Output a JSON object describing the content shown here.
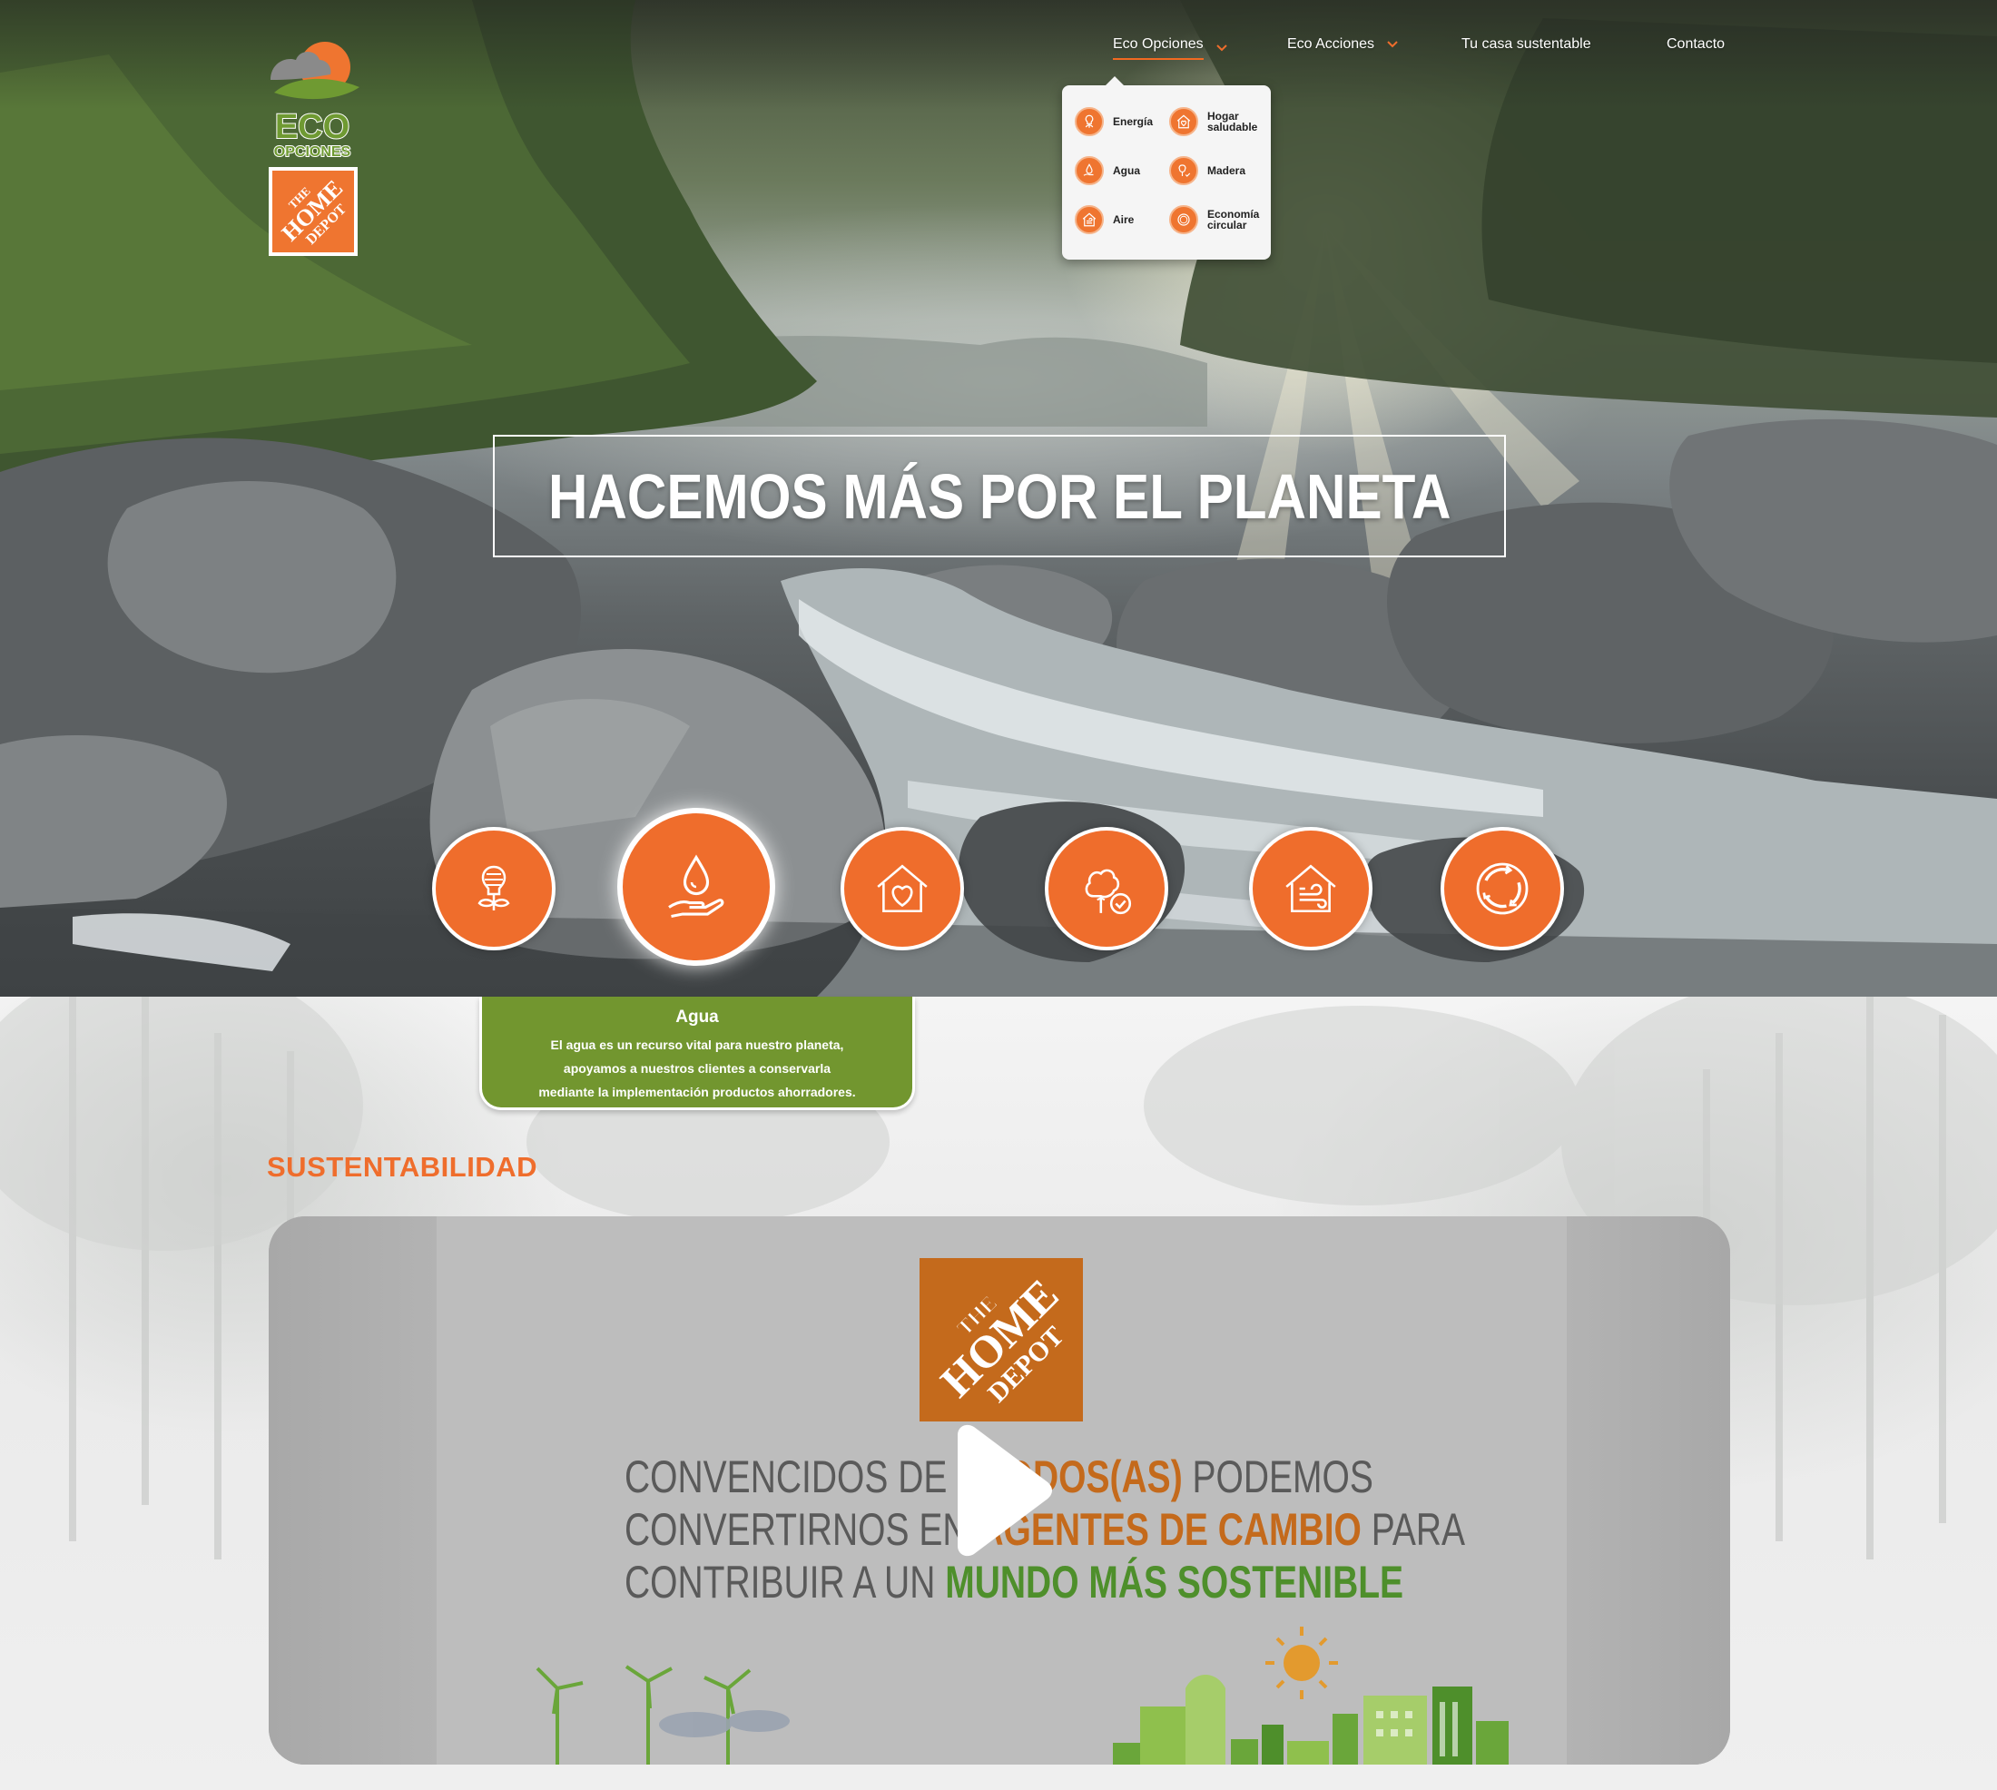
{
  "brand": {
    "logo_top": "ECO",
    "logo_sub": "OPCIONES",
    "logo_bottom_line1": "THE",
    "logo_bottom_line2": "HOME",
    "logo_bottom_line3": "DEPOT"
  },
  "nav": {
    "items": [
      {
        "label": "Eco Opciones",
        "has_dropdown": true,
        "active": true
      },
      {
        "label": "Eco Acciones",
        "has_dropdown": true,
        "active": false
      },
      {
        "label": "Tu casa sustentable",
        "has_dropdown": false,
        "active": false
      },
      {
        "label": "Contacto",
        "has_dropdown": false,
        "active": false
      }
    ]
  },
  "dropdown": {
    "items": [
      {
        "label": "Energía",
        "icon": "plant-bulb-icon"
      },
      {
        "label": "Hogar saludable",
        "icon": "heart-house-icon"
      },
      {
        "label": "Agua",
        "icon": "water-drop-hand-icon"
      },
      {
        "label": "Madera",
        "icon": "tree-check-icon"
      },
      {
        "label": "Aire",
        "icon": "wind-house-icon"
      },
      {
        "label": "Economía circular",
        "icon": "circular-arrows-icon"
      }
    ]
  },
  "hero": {
    "headline": "HACEMOS MÁS POR EL PLANETA"
  },
  "categories": [
    {
      "name": "Energía",
      "icon": "plant-bulb-icon",
      "active": false
    },
    {
      "name": "Agua",
      "icon": "water-drop-hand-icon",
      "active": true
    },
    {
      "name": "Hogar saludable",
      "icon": "heart-house-icon",
      "active": false
    },
    {
      "name": "Madera",
      "icon": "tree-check-icon",
      "active": false
    },
    {
      "name": "Aire",
      "icon": "wind-house-icon",
      "active": false
    },
    {
      "name": "Economía circular",
      "icon": "circular-arrows-icon",
      "active": false
    }
  ],
  "tooltip": {
    "title": "Agua",
    "line1": "El agua es un recurso vital para nuestro planeta,",
    "line2": "apoyamos a nuestros clientes a conservarla",
    "line3": "mediante la implementación productos ahorradores."
  },
  "section": {
    "title": "SUSTENTABILIDAD"
  },
  "video": {
    "line1_a": "CONVENCIDOS  DE  Q",
    "line1_b": "TODOS(AS)",
    "line1_c": " PODEMOS",
    "line2_a": "CONVERTIRNOS EN ",
    "line2_b": "AGENTES DE CAMBIO",
    "line2_c": " PARA",
    "line3_a": "CONTRIBUIR A UN ",
    "line3_b": "MUNDO MÁS SOSTENIBLE",
    "play_icon": "play-icon"
  },
  "colors": {
    "accent_orange": "#ef6d2c",
    "accent_green": "#72962f",
    "home_depot_orange": "#c46a1c"
  }
}
